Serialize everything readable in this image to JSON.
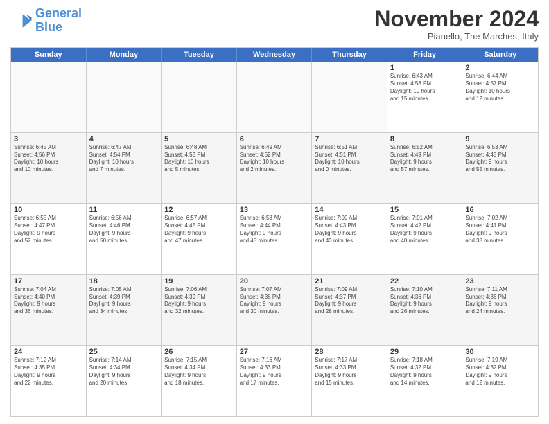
{
  "logo": {
    "line1": "General",
    "line2": "Blue"
  },
  "title": "November 2024",
  "location": "Pianello, The Marches, Italy",
  "days_header": [
    "Sunday",
    "Monday",
    "Tuesday",
    "Wednesday",
    "Thursday",
    "Friday",
    "Saturday"
  ],
  "rows": [
    [
      {
        "day": "",
        "info": "",
        "empty": true
      },
      {
        "day": "",
        "info": "",
        "empty": true
      },
      {
        "day": "",
        "info": "",
        "empty": true
      },
      {
        "day": "",
        "info": "",
        "empty": true
      },
      {
        "day": "",
        "info": "",
        "empty": true
      },
      {
        "day": "1",
        "info": "Sunrise: 6:43 AM\nSunset: 4:58 PM\nDaylight: 10 hours\nand 15 minutes.",
        "empty": false
      },
      {
        "day": "2",
        "info": "Sunrise: 6:44 AM\nSunset: 4:57 PM\nDaylight: 10 hours\nand 12 minutes.",
        "empty": false
      }
    ],
    [
      {
        "day": "3",
        "info": "Sunrise: 6:45 AM\nSunset: 4:56 PM\nDaylight: 10 hours\nand 10 minutes.",
        "empty": false
      },
      {
        "day": "4",
        "info": "Sunrise: 6:47 AM\nSunset: 4:54 PM\nDaylight: 10 hours\nand 7 minutes.",
        "empty": false
      },
      {
        "day": "5",
        "info": "Sunrise: 6:48 AM\nSunset: 4:53 PM\nDaylight: 10 hours\nand 5 minutes.",
        "empty": false
      },
      {
        "day": "6",
        "info": "Sunrise: 6:49 AM\nSunset: 4:52 PM\nDaylight: 10 hours\nand 2 minutes.",
        "empty": false
      },
      {
        "day": "7",
        "info": "Sunrise: 6:51 AM\nSunset: 4:51 PM\nDaylight: 10 hours\nand 0 minutes.",
        "empty": false
      },
      {
        "day": "8",
        "info": "Sunrise: 6:52 AM\nSunset: 4:49 PM\nDaylight: 9 hours\nand 57 minutes.",
        "empty": false
      },
      {
        "day": "9",
        "info": "Sunrise: 6:53 AM\nSunset: 4:48 PM\nDaylight: 9 hours\nand 55 minutes.",
        "empty": false
      }
    ],
    [
      {
        "day": "10",
        "info": "Sunrise: 6:55 AM\nSunset: 4:47 PM\nDaylight: 9 hours\nand 52 minutes.",
        "empty": false
      },
      {
        "day": "11",
        "info": "Sunrise: 6:56 AM\nSunset: 4:46 PM\nDaylight: 9 hours\nand 50 minutes.",
        "empty": false
      },
      {
        "day": "12",
        "info": "Sunrise: 6:57 AM\nSunset: 4:45 PM\nDaylight: 9 hours\nand 47 minutes.",
        "empty": false
      },
      {
        "day": "13",
        "info": "Sunrise: 6:58 AM\nSunset: 4:44 PM\nDaylight: 9 hours\nand 45 minutes.",
        "empty": false
      },
      {
        "day": "14",
        "info": "Sunrise: 7:00 AM\nSunset: 4:43 PM\nDaylight: 9 hours\nand 43 minutes.",
        "empty": false
      },
      {
        "day": "15",
        "info": "Sunrise: 7:01 AM\nSunset: 4:42 PM\nDaylight: 9 hours\nand 40 minutes.",
        "empty": false
      },
      {
        "day": "16",
        "info": "Sunrise: 7:02 AM\nSunset: 4:41 PM\nDaylight: 9 hours\nand 38 minutes.",
        "empty": false
      }
    ],
    [
      {
        "day": "17",
        "info": "Sunrise: 7:04 AM\nSunset: 4:40 PM\nDaylight: 9 hours\nand 36 minutes.",
        "empty": false
      },
      {
        "day": "18",
        "info": "Sunrise: 7:05 AM\nSunset: 4:39 PM\nDaylight: 9 hours\nand 34 minutes.",
        "empty": false
      },
      {
        "day": "19",
        "info": "Sunrise: 7:06 AM\nSunset: 4:39 PM\nDaylight: 9 hours\nand 32 minutes.",
        "empty": false
      },
      {
        "day": "20",
        "info": "Sunrise: 7:07 AM\nSunset: 4:38 PM\nDaylight: 9 hours\nand 30 minutes.",
        "empty": false
      },
      {
        "day": "21",
        "info": "Sunrise: 7:09 AM\nSunset: 4:37 PM\nDaylight: 9 hours\nand 28 minutes.",
        "empty": false
      },
      {
        "day": "22",
        "info": "Sunrise: 7:10 AM\nSunset: 4:36 PM\nDaylight: 9 hours\nand 26 minutes.",
        "empty": false
      },
      {
        "day": "23",
        "info": "Sunrise: 7:11 AM\nSunset: 4:36 PM\nDaylight: 9 hours\nand 24 minutes.",
        "empty": false
      }
    ],
    [
      {
        "day": "24",
        "info": "Sunrise: 7:12 AM\nSunset: 4:35 PM\nDaylight: 9 hours\nand 22 minutes.",
        "empty": false
      },
      {
        "day": "25",
        "info": "Sunrise: 7:14 AM\nSunset: 4:34 PM\nDaylight: 9 hours\nand 20 minutes.",
        "empty": false
      },
      {
        "day": "26",
        "info": "Sunrise: 7:15 AM\nSunset: 4:34 PM\nDaylight: 9 hours\nand 18 minutes.",
        "empty": false
      },
      {
        "day": "27",
        "info": "Sunrise: 7:16 AM\nSunset: 4:33 PM\nDaylight: 9 hours\nand 17 minutes.",
        "empty": false
      },
      {
        "day": "28",
        "info": "Sunrise: 7:17 AM\nSunset: 4:33 PM\nDaylight: 9 hours\nand 15 minutes.",
        "empty": false
      },
      {
        "day": "29",
        "info": "Sunrise: 7:18 AM\nSunset: 4:32 PM\nDaylight: 9 hours\nand 14 minutes.",
        "empty": false
      },
      {
        "day": "30",
        "info": "Sunrise: 7:19 AM\nSunset: 4:32 PM\nDaylight: 9 hours\nand 12 minutes.",
        "empty": false
      }
    ]
  ]
}
